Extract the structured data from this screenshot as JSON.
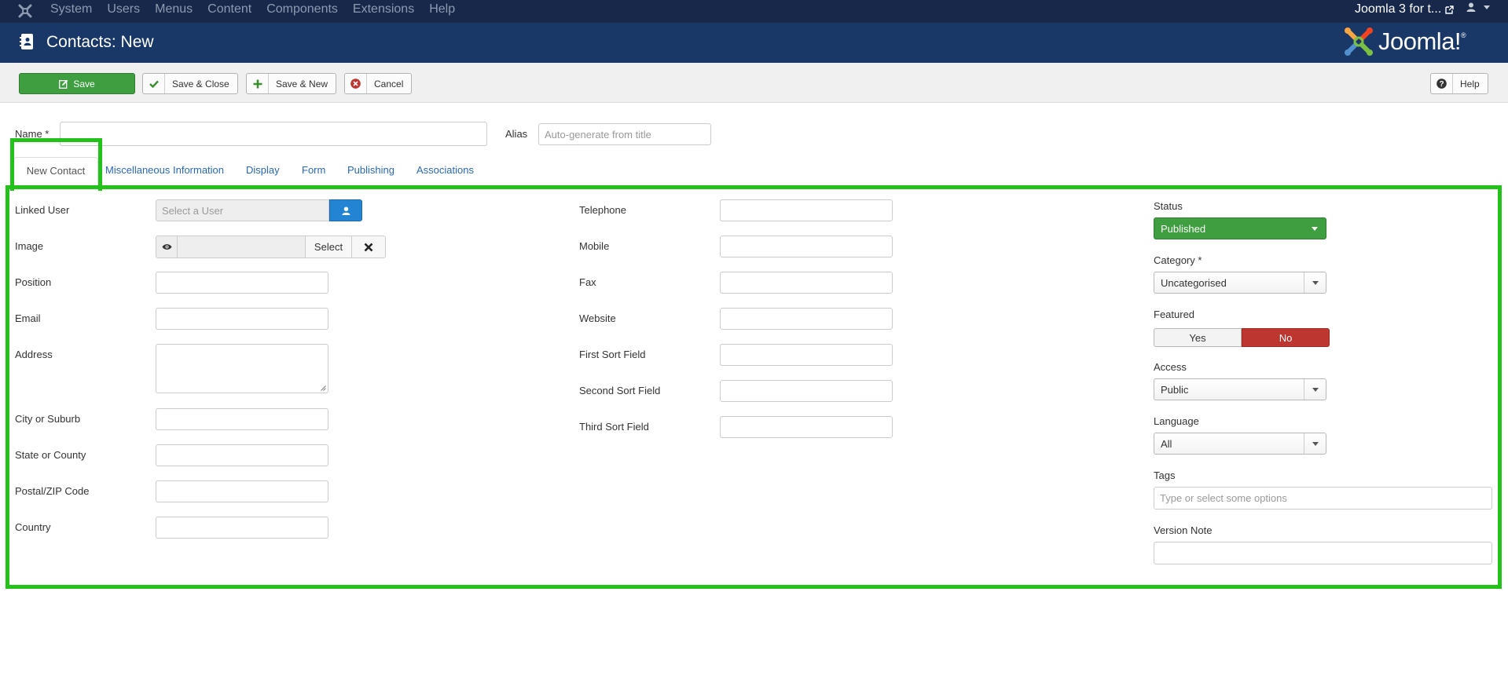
{
  "navbar": {
    "menu": [
      "System",
      "Users",
      "Menus",
      "Content",
      "Components",
      "Extensions",
      "Help"
    ],
    "site_link": "Joomla 3 for t..."
  },
  "header": {
    "title": "Contacts: New",
    "brand": "Joomla!",
    "brand_mark": "®"
  },
  "toolbar": {
    "save": "Save",
    "save_close": "Save & Close",
    "save_new": "Save & New",
    "cancel": "Cancel",
    "help": "Help"
  },
  "title_row": {
    "name_label": "Name *",
    "name_value": "",
    "alias_label": "Alias",
    "alias_placeholder": "Auto-generate from title"
  },
  "tabs": [
    "New Contact",
    "Miscellaneous Information",
    "Display",
    "Form",
    "Publishing",
    "Associations"
  ],
  "left_fields": {
    "linked_user": "Linked User",
    "linked_user_placeholder": "Select a User",
    "image": "Image",
    "image_select": "Select",
    "position": "Position",
    "email": "Email",
    "address": "Address",
    "city": "City or Suburb",
    "state": "State or County",
    "postal": "Postal/ZIP Code",
    "country": "Country"
  },
  "middle_fields": {
    "telephone": "Telephone",
    "mobile": "Mobile",
    "fax": "Fax",
    "website": "Website",
    "sort1": "First Sort Field",
    "sort2": "Second Sort Field",
    "sort3": "Third Sort Field"
  },
  "sidebar": {
    "status_label": "Status",
    "status_value": "Published",
    "category_label": "Category *",
    "category_value": "Uncategorised",
    "featured_label": "Featured",
    "featured_yes": "Yes",
    "featured_no": "No",
    "access_label": "Access",
    "access_value": "Public",
    "language_label": "Language",
    "language_value": "All",
    "tags_label": "Tags",
    "tags_placeholder": "Type or select some options",
    "version_label": "Version Note"
  },
  "colors": {
    "highlight": "#23c21b",
    "navbar": "#17284a",
    "header": "#1a3867",
    "success": "#3f9e40",
    "danger": "#bd362f",
    "primary": "#2384d3"
  }
}
